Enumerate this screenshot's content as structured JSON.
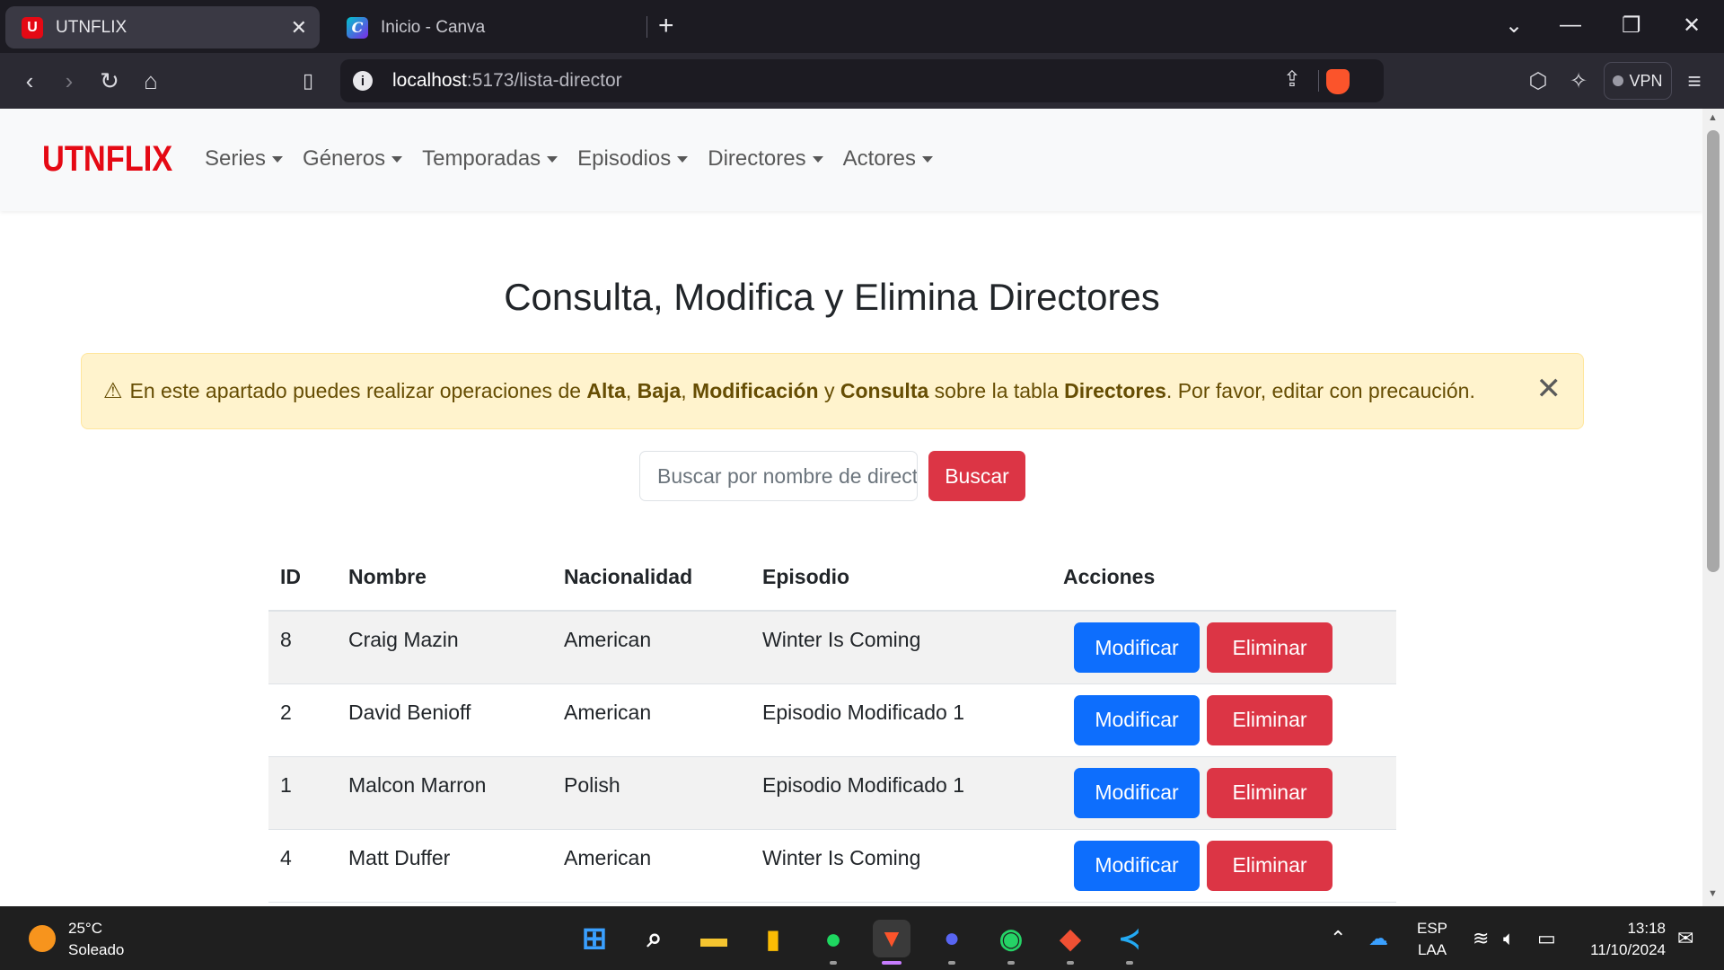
{
  "browser": {
    "tabs": [
      {
        "title": "UTNFLIX",
        "favicon": "U",
        "active": true
      },
      {
        "title": "Inicio - Canva",
        "favicon": "C",
        "active": false
      }
    ],
    "url_host": "localhost",
    "url_path": ":5173/lista-director",
    "vpn_label": "VPN"
  },
  "app": {
    "brand": "UTNFLIX",
    "nav": [
      "Series",
      "Géneros",
      "Temporadas",
      "Episodios",
      "Directores",
      "Actores"
    ],
    "title": "Consulta, Modifica y Elimina Directores",
    "alert": {
      "icon": "⚠",
      "t1": "En este apartado puedes realizar operaciones de ",
      "b1": "Alta",
      "t2": ", ",
      "b2": "Baja",
      "t3": ", ",
      "b3": "Modificación",
      "t4": " y ",
      "b4": "Consulta",
      "t5": " sobre la tabla ",
      "b5": "Directores",
      "t6": ". Por favor, editar con precaución."
    },
    "search": {
      "placeholder": "Buscar por nombre de director",
      "button": "Buscar"
    },
    "table": {
      "headers": [
        "ID",
        "Nombre",
        "Nacionalidad",
        "Episodio",
        "Acciones"
      ],
      "rows": [
        {
          "id": "8",
          "nombre": "Craig Mazin",
          "nacionalidad": "American",
          "episodio": "Winter Is Coming"
        },
        {
          "id": "2",
          "nombre": "David Benioff",
          "nacionalidad": "American",
          "episodio": "Episodio Modificado 1"
        },
        {
          "id": "1",
          "nombre": "Malcon Marron",
          "nacionalidad": "Polish",
          "episodio": "Episodio Modificado 1"
        },
        {
          "id": "4",
          "nombre": "Matt Duffer",
          "nacionalidad": "American",
          "episodio": "Winter Is Coming"
        }
      ],
      "modify_label": "Modificar",
      "delete_label": "Eliminar"
    }
  },
  "taskbar": {
    "temperature": "25°C",
    "weather": "Soleado",
    "lang_1": "ESP",
    "lang_2": "LAA",
    "time": "13:18",
    "date": "11/10/2024"
  },
  "colors": {
    "brand_red": "#e50914",
    "primary": "#0d6efd",
    "danger": "#dc3545",
    "alert_bg": "#fff3cd"
  }
}
